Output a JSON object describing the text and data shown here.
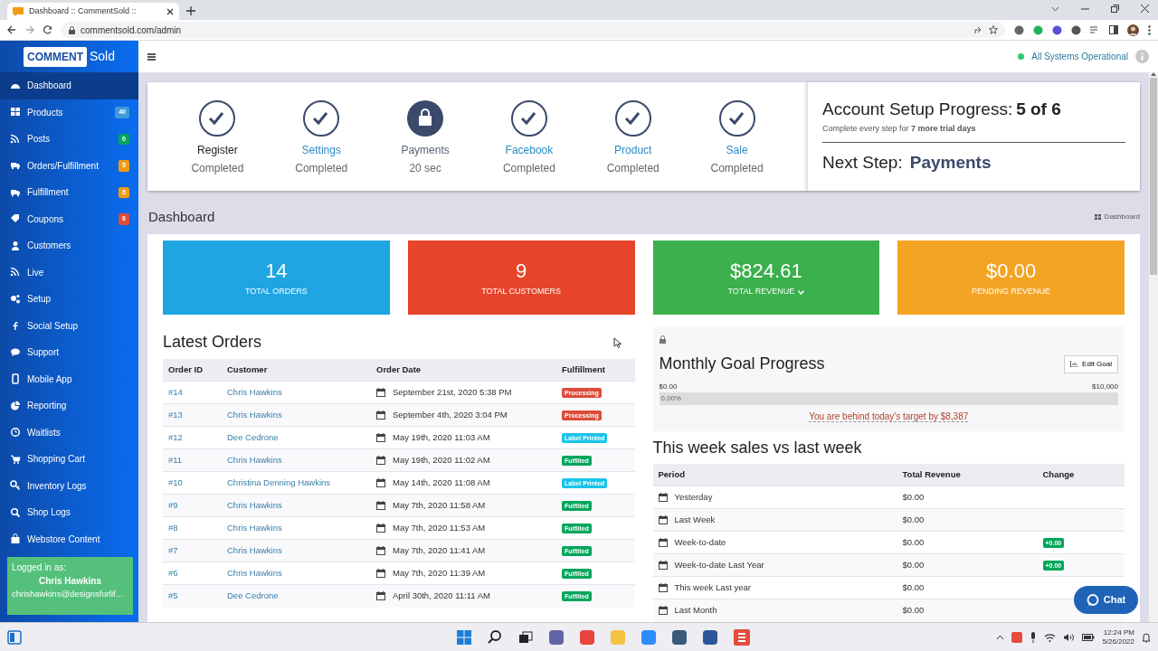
{
  "browser": {
    "tab_title": "Dashboard :: CommentSold ::",
    "url": "commentsold.com/admin"
  },
  "sidebar": {
    "logo": {
      "box_text": "COMMENT",
      "text": "Sold"
    },
    "items": [
      {
        "label": "Dashboard",
        "selected": true
      },
      {
        "label": "Products",
        "selected": false,
        "badge": "40",
        "color": "#3c9ad8"
      },
      {
        "label": "Posts",
        "selected": false,
        "badge": "0",
        "color": "#00a65a"
      },
      {
        "label": "Orders/Fulfillment",
        "selected": false,
        "badge": "5",
        "color": "#f39c12"
      },
      {
        "label": "Fulfillment",
        "selected": false,
        "badge": "5",
        "color": "#f39c12"
      },
      {
        "label": "Coupons",
        "selected": false,
        "badge": "6",
        "color": "#dd4b39"
      },
      {
        "label": "Customers",
        "selected": false
      },
      {
        "label": "Live",
        "selected": false
      },
      {
        "label": "Setup",
        "selected": false
      },
      {
        "label": "Social Setup",
        "selected": false
      },
      {
        "label": "Support",
        "selected": false
      },
      {
        "label": "Mobile App",
        "selected": false
      },
      {
        "label": "Reporting",
        "selected": false
      },
      {
        "label": "Waitlists",
        "selected": false
      },
      {
        "label": "Shopping Cart",
        "selected": false
      },
      {
        "label": "Inventory Logs",
        "selected": false
      },
      {
        "label": "Shop Logs",
        "selected": false
      },
      {
        "label": "Webstore Content",
        "selected": false
      }
    ],
    "user": {
      "caption": "Logged in as:",
      "name": "Chris Hawkins",
      "email": "chrishawkins@designsforlif..."
    }
  },
  "header": {
    "status": "All Systems Operational"
  },
  "setup": {
    "steps": [
      {
        "label": "Register",
        "status": "Completed",
        "kind": "done",
        "linked": false
      },
      {
        "label": "Settings",
        "status": "Completed",
        "kind": "done",
        "linked": true
      },
      {
        "label": "Payments",
        "status": "20 sec",
        "kind": "current",
        "linked": false
      },
      {
        "label": "Facebook",
        "status": "Completed",
        "kind": "done",
        "linked": true
      },
      {
        "label": "Product",
        "status": "Completed",
        "kind": "done",
        "linked": true
      },
      {
        "label": "Sale",
        "status": "Completed",
        "kind": "done",
        "linked": true
      }
    ],
    "progress_title": "Account Setup Progress:",
    "progress_count": "5 of 6",
    "note": "Complete every step for **7 more trial days**",
    "next_label": "Next Step:",
    "next_value": "Payments"
  },
  "page_title": "Dashboard",
  "breadcrumb": "Dashboard",
  "tiles": [
    {
      "value": "14",
      "label": "TOTAL ORDERS",
      "color": "#1ea5e2",
      "dropdown": false
    },
    {
      "value": "9",
      "label": "TOTAL CUSTOMERS",
      "color": "#e7452b",
      "dropdown": false
    },
    {
      "value": "$824.61",
      "label": "TOTAL REVENUE",
      "color": "#3bb04c",
      "dropdown": true
    },
    {
      "value": "$0.00",
      "label": "PENDING REVENUE",
      "color": "#f4a423",
      "dropdown": false
    }
  ],
  "orders": {
    "title": "Latest Orders",
    "columns": [
      "Order ID",
      "Customer",
      "Order Date",
      "Fulfillment"
    ],
    "rows": [
      {
        "id": "#14",
        "customer": "Chris Hawkins",
        "date": "September 21st, 2020 5:38 PM",
        "status": "Processing",
        "color": "#dd4b39"
      },
      {
        "id": "#13",
        "customer": "Chris Hawkins",
        "date": "September 4th, 2020 3:04 PM",
        "status": "Processing",
        "color": "#dd4b39"
      },
      {
        "id": "#12",
        "customer": "Dee Cedrone",
        "date": "May 19th, 2020 11:03 AM",
        "status": "Label Printed",
        "color": "#18c4ea"
      },
      {
        "id": "#11",
        "customer": "Chris Hawkins",
        "date": "May 19th, 2020 11:02 AM",
        "status": "Fulfilled",
        "color": "#00a65a"
      },
      {
        "id": "#10",
        "customer": "Christina Denning Hawkins",
        "date": "May 14th, 2020 11:08 AM",
        "status": "Label Printed",
        "color": "#18c4ea"
      },
      {
        "id": "#9",
        "customer": "Chris Hawkins",
        "date": "May 7th, 2020 11:58 AM",
        "status": "Fulfilled",
        "color": "#00a65a"
      },
      {
        "id": "#8",
        "customer": "Chris Hawkins",
        "date": "May 7th, 2020 11:53 AM",
        "status": "Fulfilled",
        "color": "#00a65a"
      },
      {
        "id": "#7",
        "customer": "Chris Hawkins",
        "date": "May 7th, 2020 11:41 AM",
        "status": "Fulfilled",
        "color": "#00a65a"
      },
      {
        "id": "#6",
        "customer": "Chris Hawkins",
        "date": "May 7th, 2020 11:39 AM",
        "status": "Fulfilled",
        "color": "#00a65a"
      },
      {
        "id": "#5",
        "customer": "Dee Cedrone",
        "date": "April 30th, 2020 11:11 AM",
        "status": "Fulfilled",
        "color": "#00a65a"
      }
    ]
  },
  "goal": {
    "title": "Monthly Goal Progress",
    "edit_button": "Edit Goal",
    "min": "$0.00",
    "max": "$10,000",
    "level": 0,
    "bar_text": "0.00%",
    "note": "You are behind today's target by $8,387"
  },
  "week": {
    "title": "This week sales vs last week",
    "columns": [
      "Period",
      "Total Revenue",
      "Change"
    ],
    "rows": [
      {
        "period": "Yesterday",
        "revenue": "$0.00"
      },
      {
        "period": "Last Week",
        "revenue": "$0.00"
      },
      {
        "period": "Week-to-date",
        "revenue": "$0.00",
        "change": "+0.00"
      },
      {
        "period": "Week-to-date Last Year",
        "revenue": "$0.00",
        "change": "+0.00"
      },
      {
        "period": "This week Last year",
        "revenue": "$0.00"
      },
      {
        "period": "Last Month",
        "revenue": "$0.00"
      }
    ]
  },
  "chat_button": "Chat",
  "taskbar": {
    "time": "12:24 PM",
    "date": "5/26/2022"
  }
}
